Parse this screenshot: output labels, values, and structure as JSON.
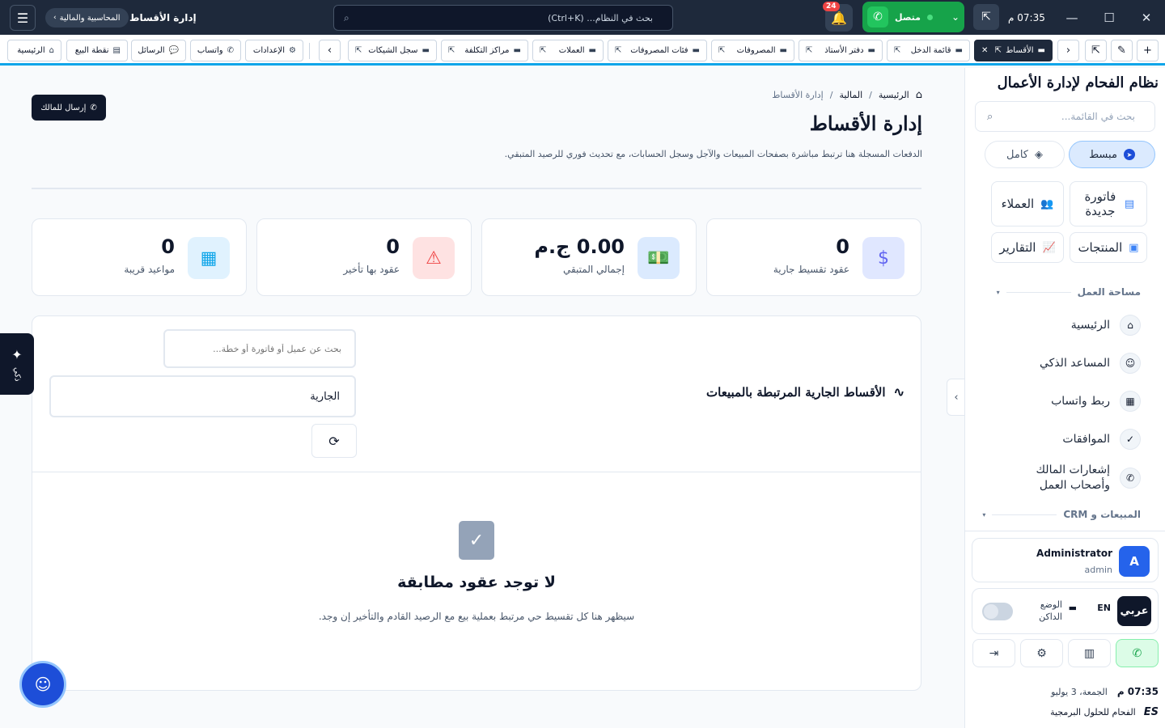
{
  "titlebar": {
    "page_title": "إدارة الأقساط",
    "breadcrumb_chip": "المحاسبية والمالية",
    "search_placeholder": "بحث في النظام... (Ctrl+K)",
    "notifications_count": "24",
    "whatsapp_status": "متصل",
    "time": "07:35 م"
  },
  "tabs": {
    "pinned": [
      {
        "label": "الرئيسية",
        "icon": "home-icon"
      },
      {
        "label": "نقطة البيع",
        "icon": "cash-register-icon"
      },
      {
        "label": "الرسائل",
        "icon": "messages-icon"
      },
      {
        "label": "واتساب",
        "icon": "whatsapp-icon"
      },
      {
        "label": "الإعدادات",
        "icon": "gear-icon"
      }
    ],
    "open": [
      {
        "label": "سجل الشيكات",
        "icon": "wallet-icon"
      },
      {
        "label": "مراكز التكلفة",
        "icon": "wallet-icon"
      },
      {
        "label": "العملات",
        "icon": "wallet-icon"
      },
      {
        "label": "فئات المصروفات",
        "icon": "wallet-icon"
      },
      {
        "label": "المصروفات",
        "icon": "wallet-icon"
      },
      {
        "label": "دفتر الأستاذ",
        "icon": "wallet-icon"
      },
      {
        "label": "قائمة الدخل",
        "icon": "wallet-icon"
      },
      {
        "label": "الأقساط",
        "icon": "wallet-icon",
        "active": true
      }
    ]
  },
  "page": {
    "breadcrumb": {
      "home": "الرئيسية",
      "section": "المالية",
      "current": "إدارة الأقساط"
    },
    "title": "إدارة الأقساط",
    "subtitle": "الدفعات المسجلة هنا ترتبط مباشرة بصفحات المبيعات والآجل وسجل الحسابات، مع تحديث فوري للرصيد المتبقي.",
    "send_owner_button": "إرسال للمالك"
  },
  "stats": [
    {
      "value": "0",
      "label": "عقود تقسيط جارية",
      "icon": "invoice-dollar-icon",
      "color": "#6366f1"
    },
    {
      "value": "0.00 ج.م",
      "label": "إجمالي المتبقي",
      "icon": "money-icon",
      "color": "#3b82f6"
    },
    {
      "value": "0",
      "label": "عقود بها تأخير",
      "icon": "warning-icon",
      "color": "#ef4444"
    },
    {
      "value": "0",
      "label": "مواعيد قريبة",
      "icon": "calendar-icon",
      "color": "#0ea5e9"
    }
  ],
  "panel": {
    "heading": "الأقساط الجارية المرتبطة بالمبيعات",
    "search_placeholder": "بحث عن عميل أو فاتورة أو خطة...",
    "status_filter": "الجارية",
    "empty_title": "لا توجد عقود مطابقة",
    "empty_text": "سيظهر هنا كل تقسيط حي مرتبط بعملية بيع مع الرصيد القادم والتأخير إن وجد."
  },
  "ai_tab": "ذكي",
  "sidebar": {
    "app_title": "نظام الفحام لإدارة الأعمال",
    "search_placeholder": "بحث في القائمة...",
    "mode_simple": "مبسط",
    "mode_full": "كامل",
    "quick": [
      {
        "label": "فاتورة جديدة",
        "icon": "file-icon"
      },
      {
        "label": "العملاء",
        "icon": "users-icon"
      },
      {
        "label": "المنتجات",
        "icon": "box-icon"
      },
      {
        "label": "التقارير",
        "icon": "chart-icon"
      }
    ],
    "section_workspace": "مساحة العمل",
    "nav": [
      {
        "label": "الرئيسية",
        "icon": "home-icon"
      },
      {
        "label": "المساعد الذكي",
        "icon": "robot-icon"
      },
      {
        "label": "ربط واتساب",
        "icon": "qr-code-icon"
      },
      {
        "label": "الموافقات",
        "icon": "check-badge-icon"
      },
      {
        "label": "إشعارات المالك وأصحاب العمل",
        "icon": "whatsapp-icon"
      }
    ],
    "section_sales": "المبيعات و CRM",
    "user": {
      "name": "Administrator",
      "role": "admin",
      "initial": "A"
    },
    "lang_ar": "عربي",
    "lang_en": "EN",
    "dark_mode": "الوضع الداكن",
    "clock_time": "07:35 م",
    "clock_date": "الجمعة، 3 يوليو",
    "company": "الفحام للحلول البرمجية",
    "company_logo": "ES"
  }
}
